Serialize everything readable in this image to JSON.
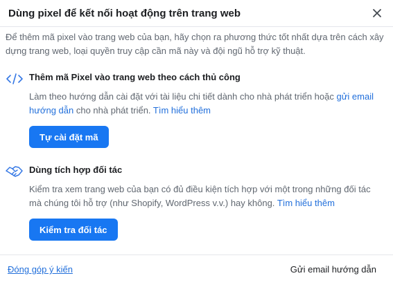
{
  "dialog": {
    "title": "Dùng pixel để kết nối hoạt động trên trang web",
    "close_icon": "close-icon",
    "intro": "Để thêm mã pixel vào trang web của bạn, hãy chọn ra phương thức tốt nhất dựa trên cách xây dựng trang web, loại quyền truy cập cần mã này và đội ngũ hỗ trợ kỹ thuật."
  },
  "manual": {
    "icon": "code-icon",
    "title": "Thêm mã Pixel vào trang web theo cách thủ công",
    "desc_text": "Làm theo hướng dẫn cài đặt với tài liệu chi tiết dành cho nhà phát triển hoặc ",
    "desc_link": "gửi email hướng dẫn",
    "desc_after": " cho nhà phát triển. ",
    "learn_more": "Tìm hiểu thêm",
    "button_label": "Tự cài đặt mã"
  },
  "partner": {
    "icon": "handshake-icon",
    "title": "Dùng tích hợp đối tác",
    "desc_text": "Kiểm tra xem trang web của bạn có đủ điều kiện tích hợp với một trong những đối tác mà chúng tôi hỗ trợ (như Shopify, WordPress v.v.) hay không. ",
    "learn_more": "Tìm hiểu thêm",
    "button_label": "Kiểm tra đối tác"
  },
  "footer": {
    "feedback_label": "Đóng góp ý kiến",
    "email_label": "Gửi email hướng dẫn"
  },
  "colors": {
    "accent": "#1877f2",
    "link": "#216fdb",
    "icon_blue": "#3578e5",
    "text_primary": "#1c1e21",
    "text_secondary": "#606770"
  }
}
